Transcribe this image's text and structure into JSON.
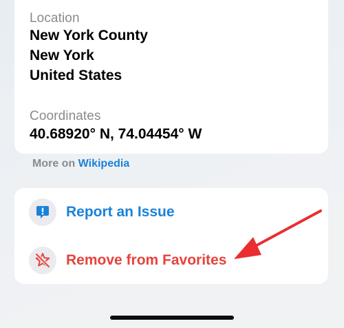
{
  "details": {
    "location_label": "Location",
    "location_lines": [
      "New York County",
      "New York",
      "United States"
    ],
    "coordinates_label": "Coordinates",
    "coordinates_value": "40.68920° N, 74.04454° W"
  },
  "more": {
    "prefix": "More on",
    "link": "Wikipedia"
  },
  "actions": {
    "report_label": "Report an Issue",
    "report_icon": "report-bubble-icon",
    "remove_label": "Remove from Favorites",
    "remove_icon": "star-slash-icon"
  },
  "colors": {
    "link_blue": "#1a82d8",
    "destructive_red": "#e6433c",
    "annotation_arrow": "#ea2e2f"
  }
}
